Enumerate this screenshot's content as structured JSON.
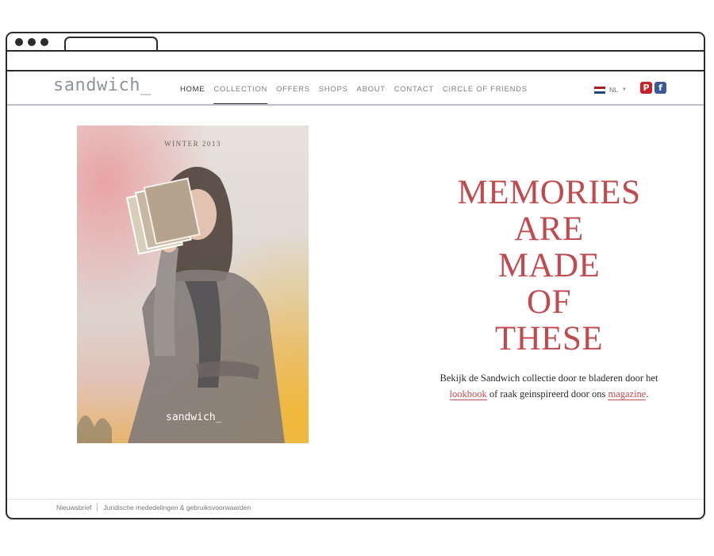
{
  "header": {
    "logo": "sandwich_",
    "nav": [
      "HOME",
      "COLLECTION",
      "OFFERS",
      "SHOPS",
      "ABOUT",
      "CONTACT",
      "CIRCLE OF FRIENDS"
    ],
    "language": "NL",
    "social": {
      "pinterest": "P",
      "facebook": "f"
    }
  },
  "cover": {
    "season": "WINTER 2013",
    "brand": "sandwich_"
  },
  "headline": [
    "MEMORIES",
    "ARE",
    "MADE",
    "OF",
    "THESE"
  ],
  "description": {
    "part1": "Bekijk de Sandwich collectie door te bladeren door het ",
    "link1": "lookbook",
    "part2": " of raak geinspireerd door ons ",
    "link2": "magazine",
    "part3": "."
  },
  "footer": {
    "links": [
      "Nieuwsbrief",
      "Juridische mededelingen & gebruiksvoorwaarden"
    ]
  },
  "colors": {
    "accent": "#c14a4f",
    "logo": "#8d949b",
    "pinterest": "#cb2027",
    "facebook": "#3b5998"
  }
}
